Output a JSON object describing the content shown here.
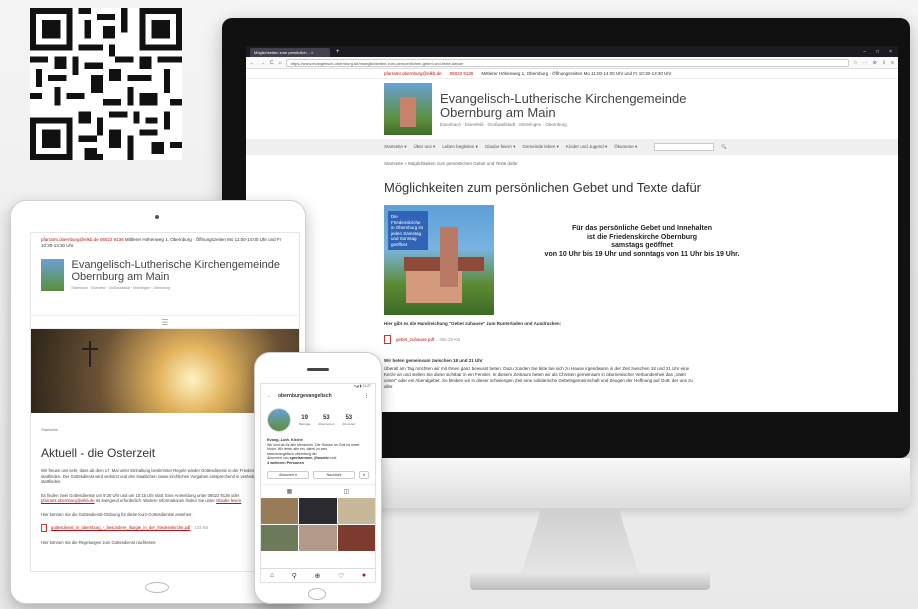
{
  "desktop": {
    "browser": {
      "tab_title": "Möglichkeiten zum persönlich...",
      "tab_close": "×",
      "new_tab": "+",
      "window_controls": [
        "–",
        "□",
        "×"
      ],
      "nav": [
        "←",
        "→",
        "C",
        "⌂"
      ],
      "url": "https://www.evangelisch-obernburg.de/moeglichkeiten-zum-persoenlichen-gebet-und-texte-dafuer",
      "tools": [
        "☆",
        "⋯",
        "⊘",
        "⇩",
        "≡"
      ]
    },
    "site": {
      "email": "pfarramt.obernburg@elkb.de",
      "phone": "06022 9136",
      "address": "Mittlerer Höhenweg 1, Obernburg · Öffnungszeiten Mo 11:00-14:00 Uhr und Fr 10:30-13:30 Uhr",
      "title_line1": "Evangelisch-Lutherische Kirchengemeinde",
      "title_line2": "Obernburg am Main",
      "subtitle": "Eisenbach · Eisenfeld · Großwallstadt · Mömlingen · Obernburg",
      "nav": [
        "Startseite ▾",
        "Über uns ▾",
        "Leben begleiten ▾",
        "Glaube feiern ▾",
        "Gemeinde leben ▾",
        "Kinder und Jugend ▾",
        "Ökumene ▾"
      ],
      "search_icon": "🔍",
      "breadcrumb": "Startseite » Möglichkeiten zum persönlichen Gebet und Texte dafür",
      "page_title": "Möglichkeiten zum persönlichen Gebet und Texte dafür",
      "poster_label": "Die Friedenskirche in Obernburg ist jeden Samstag und Sonntag geöffnet",
      "notice_line1": "Für das persönliche Gebet und Innehalten",
      "notice_line2": "ist die Friedenskirche Obernburg",
      "notice_line3": "samstags geöffnet",
      "notice_line4": "von 10 Uhr bis 19 Uhr und sonntags von 11 Uhr bis 19 Uhr.",
      "handout_text": "Hier gibt es die Handreichung \"Gebet zuhause\" zum Runterladen und Ausdrucken:",
      "file_name": "gebet_zuhause.pdf",
      "file_size": "356,29 KB",
      "prayer_heading": "Wir beten gemeinsam zwischen 18 und 21 Uhr",
      "prayer_text": "Überall am Tag möchten wir mit Ihnen ganz bewusst beten. Dazu zünden Sie bitte bei sich zu Hause irgendwann in der Zeit zwischen 18 und 21 Uhr eine Kerze an und stellen Sie diese sichtbar in ein Fenster. In diesem Zeitraum beten wir als Christen gemeinsam in ökumenischer Verbundenheit das „Vater unser“ oder ein Abendgebet. So bleiben wir in dieser schwierigen Zeit eine solidarische Gebetsgemeinschaft und Zeugen der Hoffnung auf Gott, der uns zu aller"
    }
  },
  "tablet": {
    "email": "pfarramt.obernburg@elkb.de",
    "phone": "06022 9136",
    "address": "Mittlerer Höhenweg 1, Obernburg · Öffnungszeiten Mo 11:00-14:00 Uhr und Fr 10:30-13:30 Uhr",
    "title": "Evangelisch-Lutherische Kirchengemeinde Obernburg am Main",
    "subtitle": "Eisenbach · Eisenfeld · Großwallstadt · Mömlingen · Obernburg",
    "menu_icon": "☰",
    "breadcrumb": "Startseite",
    "heading": "Aktuell - die Osterzeit",
    "para1": "Wir freuen uns sehr, dass ab dem 17. Mai unter Einhaltung bestimmter Regeln wieder Gottesdienste in der Friedenskirche Obernburg stattfinden. Der Gottesdienst wird verkürzt und den staatlichen sowie kirchlichen Vorgaben entsprechend in veränderter Weise stattfinden.",
    "para2_a": "Es finden zwei Gottesdienste um 9:30 Uhr und um 10:15 Uhr statt. Eine Anmeldung unter 06022 9136 oder",
    "para2_link": "pfarramt.obernburg@elkb.de",
    "para2_b": "ist zwingend erforderlich. Weitere Informationen finden Sie unter",
    "para2_link2": "Glaube feiern",
    "para3": "Hier können Sie die Gottesdienst-Ordnung für diese Kurz-Gottesdienste ansehen:",
    "file_name": "gottesdienst_in_obernburg_-_besondere_liturgie_in_der_friedenskirche.pdf",
    "file_size": "133 KB",
    "para4": "Hier können Sie die Regelungen zum Gottesdienst nachlesen:"
  },
  "phone": {
    "status": "▾◢ ▮ 11:27",
    "back": "←",
    "username": "obernburgevangelisch",
    "more": "⋮",
    "posts": "19",
    "posts_label": "Beiträge",
    "followers": "53",
    "followers_label": "Abonnenten",
    "following": "53",
    "following_label": "Abonniert",
    "bio_name": "Evang.-Luth. Kirche",
    "bio1": "Wir sind da für alle Menschen. Der Glaube an Gott ist unser Motor. Wir leben alle ein, dabei zu sein.",
    "bio_url": "www.evangelisch-obernburg.de/",
    "bio2": "Abonniert von",
    "bio2_b": "sperlarnmen",
    "bio2_c": "jfioszeln",
    "bio2_d": "und",
    "bio3": "4 weiteren Personen",
    "btn_follow": "Abonniert ▾",
    "btn_message": "Nachricht",
    "btn_more": "▾",
    "tab_grid": "▦",
    "tab_tagged": "◫",
    "bottom": [
      "⌂",
      "⚲",
      "⊕",
      "♡",
      "●"
    ]
  },
  "colors": {
    "accent_red": "#b11111",
    "poster_blue": "#2f64b6"
  }
}
